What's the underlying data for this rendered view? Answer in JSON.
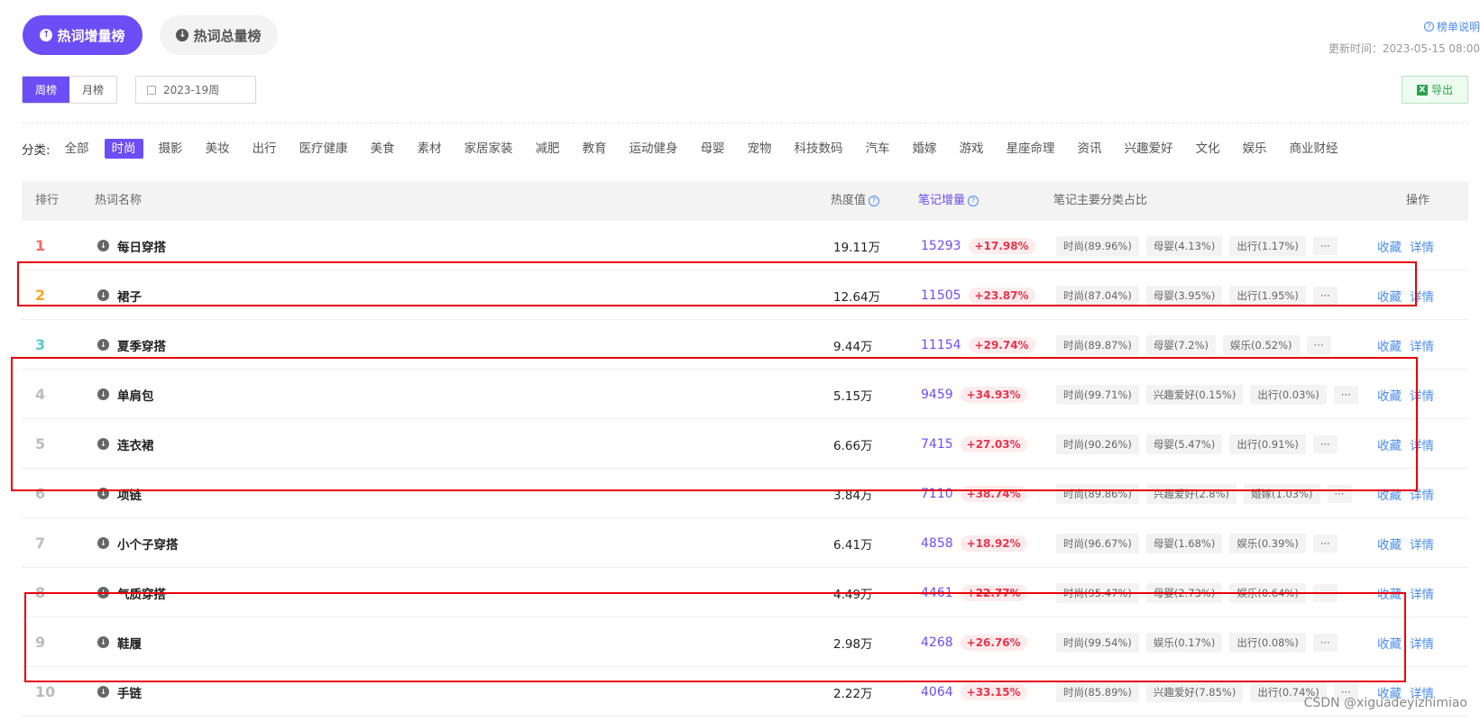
{
  "tabs": [
    {
      "label": "热词增量榜",
      "icon": "arrow-up-circle-icon"
    },
    {
      "label": "热词总量榜",
      "icon": "arrow-down-circle-icon"
    }
  ],
  "explain_label": "榜单说明",
  "update_time": "更新时间：2023-05-15 08:00",
  "period": {
    "week": "周榜",
    "month": "月榜"
  },
  "date_value": "2023-19周",
  "export_label": "导出",
  "category_label": "分类:",
  "categories": [
    "全部",
    "时尚",
    "摄影",
    "美妆",
    "出行",
    "医疗健康",
    "美食",
    "素材",
    "家居家装",
    "减肥",
    "教育",
    "运动健身",
    "母婴",
    "宠物",
    "科技数码",
    "汽车",
    "婚嫁",
    "游戏",
    "星座命理",
    "资讯",
    "兴趣爱好",
    "文化",
    "娱乐",
    "商业财经"
  ],
  "selected_category": "时尚",
  "headers": {
    "rank": "排行",
    "name": "热词名称",
    "heat": "热度值",
    "inc": "笔记增量",
    "share": "笔记主要分类占比",
    "ops": "操作"
  },
  "ops": {
    "fav": "收藏",
    "detail": "详情"
  },
  "more_label": "···",
  "rows": [
    {
      "rank": "1",
      "name": "每日穿搭",
      "heat": "19.11万",
      "inc": "15293",
      "pct": "+17.98%",
      "tags": [
        "时尚(89.96%)",
        "母婴(4.13%)",
        "出行(1.17%)"
      ]
    },
    {
      "rank": "2",
      "name": "裙子",
      "heat": "12.64万",
      "inc": "11505",
      "pct": "+23.87%",
      "tags": [
        "时尚(87.04%)",
        "母婴(3.95%)",
        "出行(1.95%)"
      ]
    },
    {
      "rank": "3",
      "name": "夏季穿搭",
      "heat": "9.44万",
      "inc": "11154",
      "pct": "+29.74%",
      "tags": [
        "时尚(89.87%)",
        "母婴(7.2%)",
        "娱乐(0.52%)"
      ]
    },
    {
      "rank": "4",
      "name": "单肩包",
      "heat": "5.15万",
      "inc": "9459",
      "pct": "+34.93%",
      "tags": [
        "时尚(99.71%)",
        "兴趣爱好(0.15%)",
        "出行(0.03%)"
      ]
    },
    {
      "rank": "5",
      "name": "连衣裙",
      "heat": "6.66万",
      "inc": "7415",
      "pct": "+27.03%",
      "tags": [
        "时尚(90.26%)",
        "母婴(5.47%)",
        "出行(0.91%)"
      ]
    },
    {
      "rank": "6",
      "name": "项链",
      "heat": "3.84万",
      "inc": "7110",
      "pct": "+38.74%",
      "tags": [
        "时尚(89.86%)",
        "兴趣爱好(2.8%)",
        "婚嫁(1.03%)"
      ]
    },
    {
      "rank": "7",
      "name": "小个子穿搭",
      "heat": "6.41万",
      "inc": "4858",
      "pct": "+18.92%",
      "tags": [
        "时尚(96.67%)",
        "母婴(1.68%)",
        "娱乐(0.39%)"
      ]
    },
    {
      "rank": "8",
      "name": "气质穿搭",
      "heat": "4.49万",
      "inc": "4461",
      "pct": "+22.77%",
      "tags": [
        "时尚(95.47%)",
        "母婴(2.73%)",
        "娱乐(0.64%)"
      ]
    },
    {
      "rank": "9",
      "name": "鞋履",
      "heat": "2.98万",
      "inc": "4268",
      "pct": "+26.76%",
      "tags": [
        "时尚(99.54%)",
        "娱乐(0.17%)",
        "出行(0.08%)"
      ]
    },
    {
      "rank": "10",
      "name": "手链",
      "heat": "2.22万",
      "inc": "4064",
      "pct": "+33.15%",
      "tags": [
        "时尚(85.89%)",
        "兴趣爱好(7.85%)",
        "出行(0.74%)"
      ]
    }
  ],
  "watermark": "CSDN @xiguadeyizhimiao",
  "colors": {
    "accent": "#6b4ef6",
    "rank1": "#f06a5c",
    "rank2": "#f5a623",
    "rank3": "#5bc8cf",
    "increase": "#e8344a",
    "link": "#4a8cf0",
    "annotation": "#e8000b"
  }
}
